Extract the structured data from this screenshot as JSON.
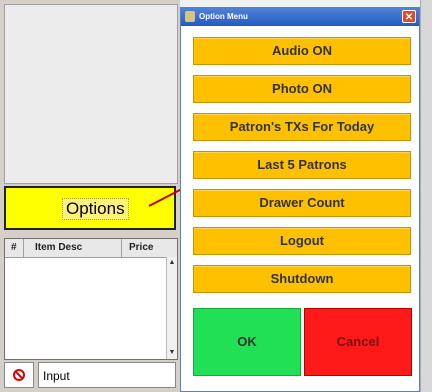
{
  "dialog": {
    "title": "Option Menu",
    "close_symbol": "✕",
    "buttons": [
      {
        "label": "Audio ON"
      },
      {
        "label": "Photo ON"
      },
      {
        "label": "Patron's TXs For Today"
      },
      {
        "label": "Last 5 Patrons"
      },
      {
        "label": "Drawer Count"
      },
      {
        "label": "Logout"
      },
      {
        "label": "Shutdown"
      }
    ],
    "ok_label": "OK",
    "cancel_label": "Cancel"
  },
  "pos": {
    "options_label": "Options",
    "table_columns": [
      "#",
      "Item Desc",
      "Price"
    ],
    "input_label": "Input",
    "stop_icon": "no-entry-icon"
  },
  "colors": {
    "option_button": "#ffc000",
    "ok": "#22e055",
    "cancel": "#ff1a1a",
    "options_panel": "#ffff00",
    "titlebar": "#2459c3"
  }
}
